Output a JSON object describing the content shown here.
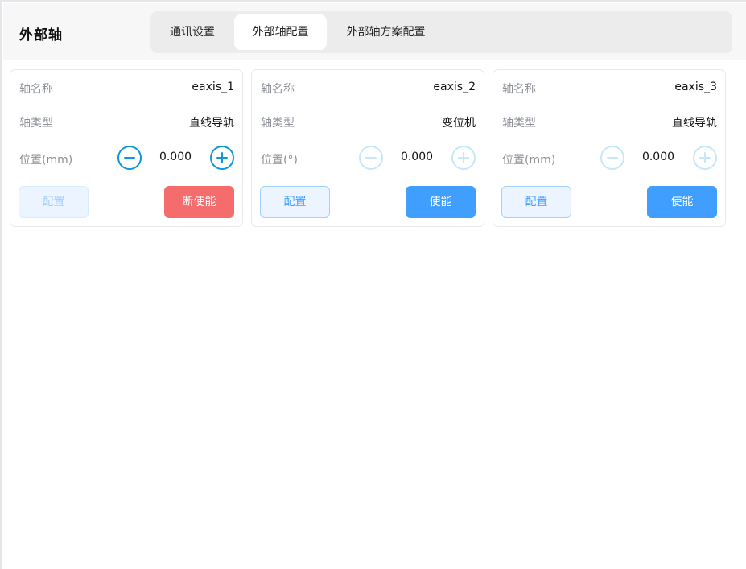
{
  "page_title": "外部轴",
  "tabs": [
    {
      "label": "通讯设置",
      "active": false
    },
    {
      "label": "外部轴配置",
      "active": true
    },
    {
      "label": "外部轴方案配置",
      "active": false
    }
  ],
  "cards": [
    {
      "name_label": "轴名称",
      "name_value": "eaxis_1",
      "type_label": "轴类型",
      "type_value": "直线导轨",
      "position_label": "位置(mm)",
      "position_value": "0.000",
      "stepper_enabled": true,
      "config_label": "配置",
      "config_disabled": true,
      "enable_label": "断使能",
      "enable_style": "danger"
    },
    {
      "name_label": "轴名称",
      "name_value": "eaxis_2",
      "type_label": "轴类型",
      "type_value": "变位机",
      "position_label": "位置(°)",
      "position_value": "0.000",
      "stepper_enabled": false,
      "config_label": "配置",
      "config_disabled": false,
      "enable_label": "使能",
      "enable_style": "primary"
    },
    {
      "name_label": "轴名称",
      "name_value": "eaxis_3",
      "type_label": "轴类型",
      "type_value": "直线导轨",
      "position_label": "位置(mm)",
      "position_value": "0.000",
      "stepper_enabled": false,
      "config_label": "配置",
      "config_disabled": false,
      "enable_label": "使能",
      "enable_style": "primary"
    }
  ],
  "colors": {
    "primary": "#409eff",
    "danger": "#f56c6c",
    "stepper_active": "#1296db",
    "stepper_disabled": "#c5e7f7"
  },
  "icons": {
    "decrease": "minus-circle-icon",
    "increase": "plus-circle-icon"
  }
}
